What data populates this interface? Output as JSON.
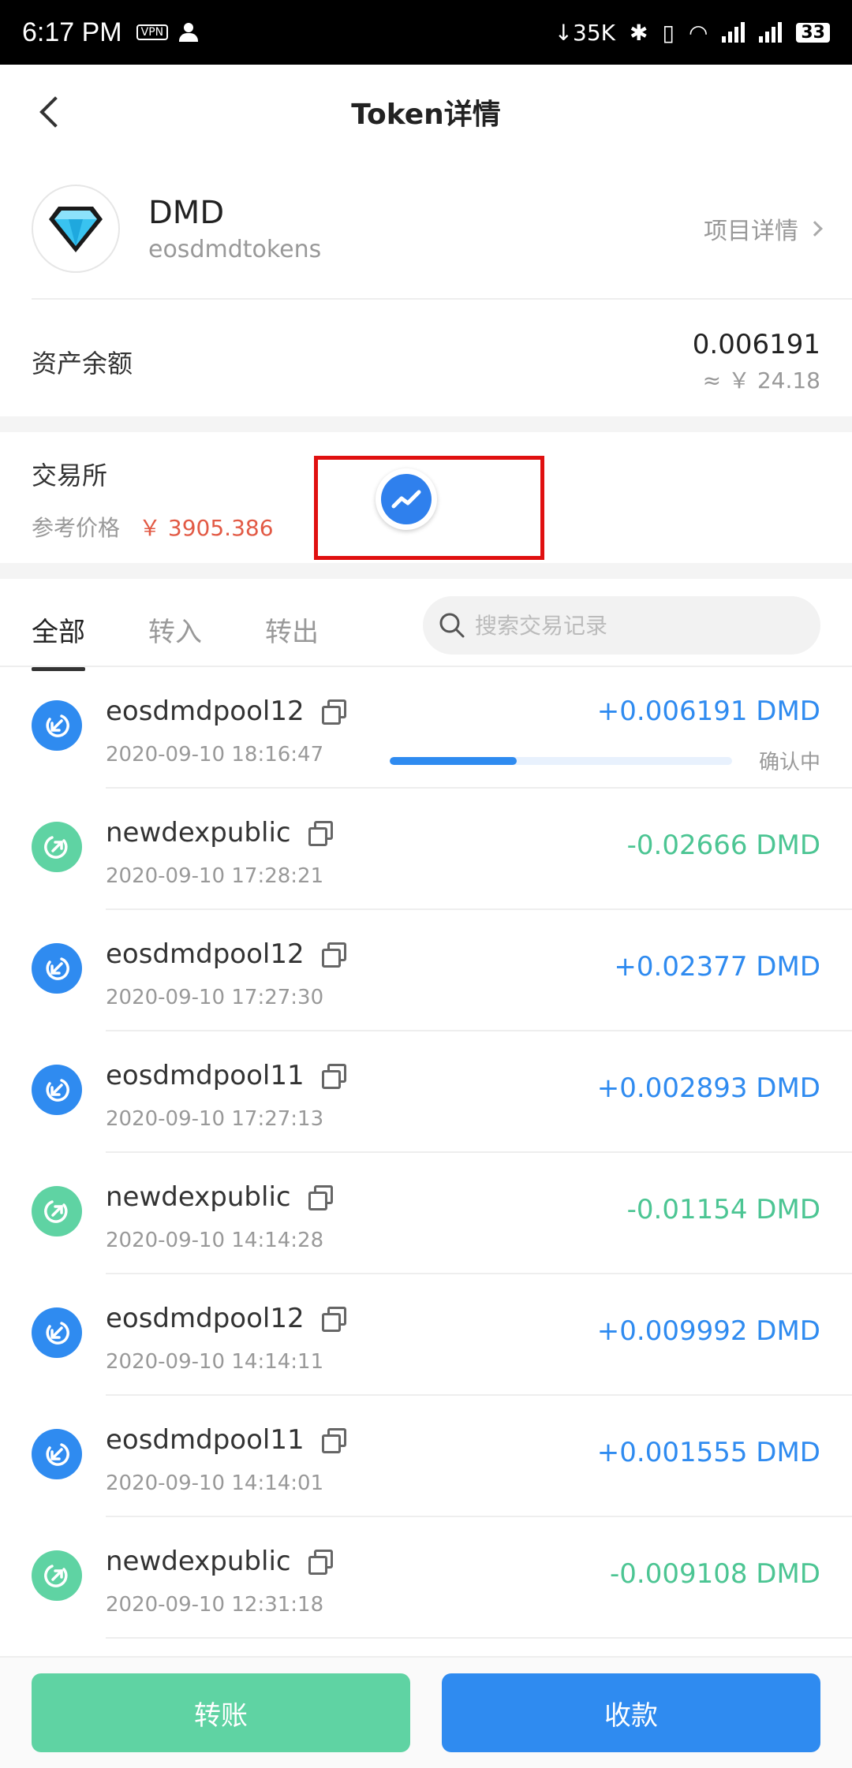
{
  "status_bar": {
    "time": "6:17 PM",
    "vpn": "VPN",
    "net_speed": "35K",
    "battery": "33"
  },
  "header": {
    "title": "Token详情"
  },
  "token": {
    "symbol": "DMD",
    "contract": "eosdmdtokens",
    "project_link": "项目详情"
  },
  "balance": {
    "label": "资产余额",
    "amount": "0.006191",
    "fiat": "≈ ￥ 24.18"
  },
  "exchange": {
    "title": "交易所",
    "ref_label": "参考价格",
    "ref_price": "￥ 3905.386"
  },
  "tabs": [
    {
      "label": "全部"
    },
    {
      "label": "转入"
    },
    {
      "label": "转出"
    }
  ],
  "search": {
    "placeholder": "搜索交易记录"
  },
  "transactions": [
    {
      "name": "eosdmdpool12",
      "time": "2020-09-10 18:16:47",
      "amount": "+0.006191 DMD",
      "direction": "in",
      "status": "确认中",
      "progress": 0.37
    },
    {
      "name": "newdexpublic",
      "time": "2020-09-10 17:28:21",
      "amount": "-0.02666 DMD",
      "direction": "out"
    },
    {
      "name": "eosdmdpool12",
      "time": "2020-09-10 17:27:30",
      "amount": "+0.02377 DMD",
      "direction": "in"
    },
    {
      "name": "eosdmdpool11",
      "time": "2020-09-10 17:27:13",
      "amount": "+0.002893 DMD",
      "direction": "in"
    },
    {
      "name": "newdexpublic",
      "time": "2020-09-10 14:14:28",
      "amount": "-0.01154 DMD",
      "direction": "out"
    },
    {
      "name": "eosdmdpool12",
      "time": "2020-09-10 14:14:11",
      "amount": "+0.009992 DMD",
      "direction": "in"
    },
    {
      "name": "eosdmdpool11",
      "time": "2020-09-10 14:14:01",
      "amount": "+0.001555 DMD",
      "direction": "in"
    },
    {
      "name": "newdexpublic",
      "time": "2020-09-10 12:31:18",
      "amount": "-0.009108 DMD",
      "direction": "out"
    }
  ],
  "actions": {
    "transfer_label": "转账",
    "receive_label": "收款"
  },
  "colors": {
    "in": "#2f8bf0",
    "out": "#5fd3a3",
    "price": "#e25a45",
    "highlight": "#e01010"
  }
}
